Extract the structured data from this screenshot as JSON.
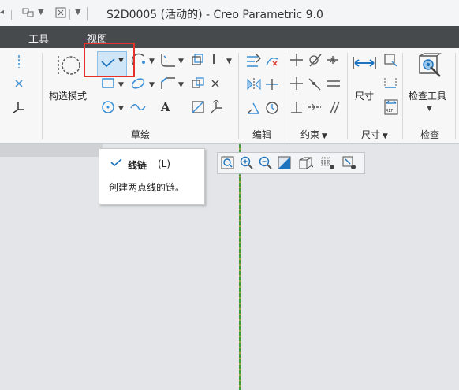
{
  "window": {
    "title": "S2D0005 (活动的) - Creo Parametric 9.0"
  },
  "menu": {
    "tools": "工具",
    "view": "视图"
  },
  "ribbon": {
    "construction_mode": "构造模式",
    "dimension": "尺寸",
    "inspect_tool": "检查工具",
    "groups": {
      "sketch": "草绘",
      "edit": "编辑",
      "constrain": "约束",
      "dimension": "尺寸",
      "inspect": "检查"
    },
    "text_tool_glyph": "A"
  },
  "tooltip": {
    "title": "线链",
    "shortcut": "(L)",
    "description": "创建两点线的链。"
  },
  "colors": {
    "accent_blue": "#3a8fd6",
    "highlight_red": "#e5312a",
    "centerline_green": "#3f9a3f",
    "menubar": "#474a4d"
  }
}
